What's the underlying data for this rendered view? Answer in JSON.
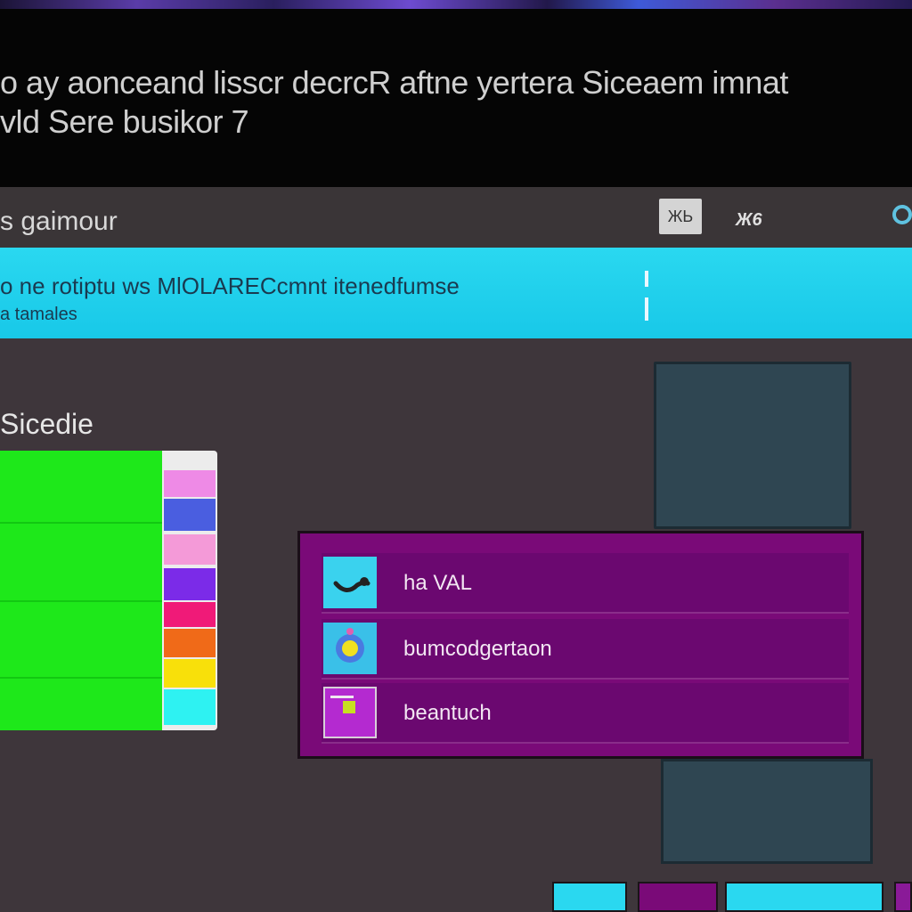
{
  "header": {
    "line1": "o ay aonceand lisscr decrcR aftne yertera Siceaem imnat",
    "line2": "vld Sere busikor 7"
  },
  "toolbar": {
    "title": "s gaimour",
    "button_label": "ЖЬ",
    "count": "Ж6"
  },
  "banner": {
    "line1": "o ne rotiptu ws MlOLARECcmnt itenedfumse",
    "line2": "a tamales"
  },
  "section": {
    "title": "Sicedie"
  },
  "palette": {
    "green": "#1ee81a",
    "swatches": [
      "#ee8ae6",
      "#4a5ee0",
      "#f49ad8",
      "#7b2be8",
      "#f01a78",
      "#f06a18",
      "#f8e00a",
      "#2ef2f2"
    ]
  },
  "menu": {
    "items": [
      {
        "label": "ha VAL",
        "icon": "swoosh-icon"
      },
      {
        "label": "bumcodgertaon",
        "icon": "flower-icon"
      },
      {
        "label": "beantuch",
        "icon": "document-icon"
      }
    ]
  },
  "colors": {
    "banner": "#18c8e8",
    "menu": "#7a0a78",
    "card": "#2f4652"
  }
}
